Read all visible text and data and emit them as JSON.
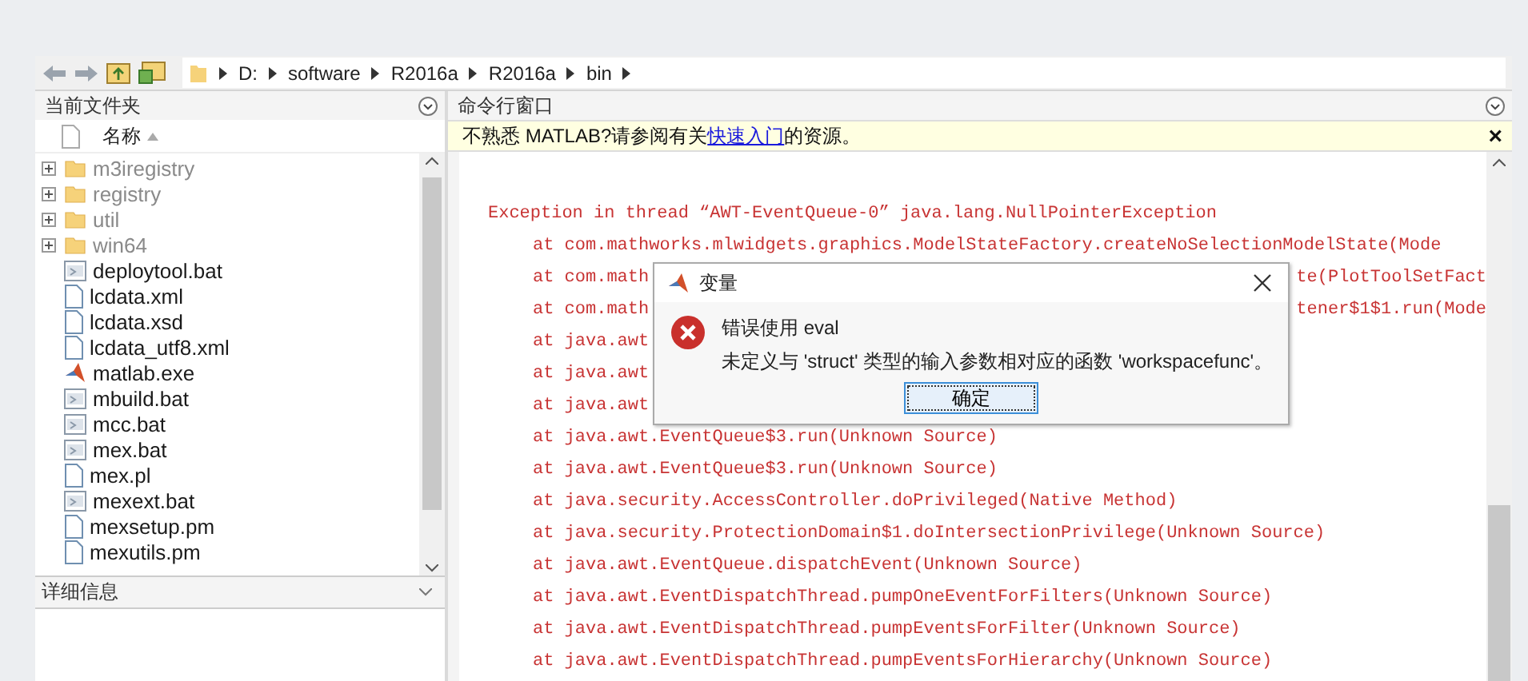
{
  "path_bar": {
    "segments": [
      "D:",
      "software",
      "R2016a",
      "R2016a",
      "bin"
    ]
  },
  "current_folder": {
    "title": "当前文件夹",
    "column": "名称",
    "files": [
      {
        "name": "m3iregistry",
        "kind": "folder"
      },
      {
        "name": "registry",
        "kind": "folder"
      },
      {
        "name": "util",
        "kind": "folder"
      },
      {
        "name": "win64",
        "kind": "folder"
      },
      {
        "name": "deploytool.bat",
        "kind": "bat"
      },
      {
        "name": "lcdata.xml",
        "kind": "file"
      },
      {
        "name": "lcdata.xsd",
        "kind": "file"
      },
      {
        "name": "lcdata_utf8.xml",
        "kind": "file"
      },
      {
        "name": "matlab.exe",
        "kind": "exe"
      },
      {
        "name": "mbuild.bat",
        "kind": "bat"
      },
      {
        "name": "mcc.bat",
        "kind": "bat"
      },
      {
        "name": "mex.bat",
        "kind": "bat"
      },
      {
        "name": "mex.pl",
        "kind": "file"
      },
      {
        "name": "mexext.bat",
        "kind": "bat"
      },
      {
        "name": "mexsetup.pm",
        "kind": "file"
      },
      {
        "name": "mexutils.pm",
        "kind": "file"
      }
    ],
    "details_title": "详细信息"
  },
  "command_window": {
    "title": "命令行窗口",
    "notice": {
      "before": "不熟悉 MATLAB?请参阅有关",
      "link": "快速入门",
      "after": "的资源。",
      "close": "×"
    },
    "lines": [
      {
        "kind": "exception",
        "text": "Exception in thread “AWT-EventQueue-0” java.lang.NullPointerException"
      },
      {
        "kind": "frame",
        "text": "at com.mathworks.mlwidgets.graphics.ModelStateFactory.createNoSelectionModelState(Mode"
      },
      {
        "kind": "frame",
        "text": "at com.math",
        "tail": "te(PlotToolSetFact"
      },
      {
        "kind": "frame",
        "text": "at com.math",
        "tail": "tener$1$1.run(Mode"
      },
      {
        "kind": "frame",
        "text": "at java.awt"
      },
      {
        "kind": "frame",
        "text": "at java.awt"
      },
      {
        "kind": "frame",
        "text": "at java.awt"
      },
      {
        "kind": "frame",
        "text": "at java.awt.EventQueue$3.run(Unknown Source)"
      },
      {
        "kind": "frame",
        "text": "at java.awt.EventQueue$3.run(Unknown Source)"
      },
      {
        "kind": "frame",
        "text": "at java.security.AccessController.doPrivileged(Native Method)"
      },
      {
        "kind": "frame",
        "text": "at java.security.ProtectionDomain$1.doIntersectionPrivilege(Unknown Source)"
      },
      {
        "kind": "frame",
        "text": "at java.awt.EventQueue.dispatchEvent(Unknown Source)"
      },
      {
        "kind": "frame",
        "text": "at java.awt.EventDispatchThread.pumpOneEventForFilters(Unknown Source)"
      },
      {
        "kind": "frame",
        "text": "at java.awt.EventDispatchThread.pumpEventsForFilter(Unknown Source)"
      },
      {
        "kind": "frame",
        "text": "at java.awt.EventDispatchThread.pumpEventsForHierarchy(Unknown Source)"
      }
    ]
  },
  "dialog": {
    "title": "变量",
    "heading": "错误使用 eval",
    "message": "未定义与 'struct' 类型的输入参数相对应的函数 'workspacefunc'。",
    "button": "确定"
  }
}
